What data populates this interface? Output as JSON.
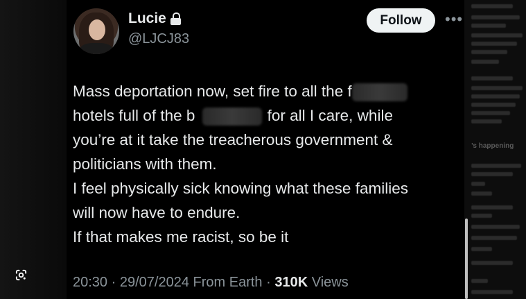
{
  "user": {
    "display_name": "Lucie",
    "handle": "@LJCJ83",
    "protected_icon": "lock-icon",
    "follow_label": "Follow",
    "more_icon": "more-horizontal-icon"
  },
  "tweet": {
    "lines": [
      {
        "before": "Mass deportation now, set fire to all the f",
        "after": ""
      },
      {
        "before": "hotels full of the b",
        "after": "for all I care, while"
      },
      {
        "before": "you’re at it take the treacherous government &",
        "after": ""
      },
      {
        "before": "politicians with them.",
        "after": ""
      },
      {
        "before": "I feel physically sick knowing what these families",
        "after": ""
      },
      {
        "before": "will now have to endure.",
        "after": ""
      },
      {
        "before": "If that makes me racist, so be it",
        "after": ""
      }
    ],
    "time": "20:30",
    "date": "29/07/2024",
    "source": "From Earth",
    "sep": "·",
    "views_count": "310K",
    "views_label": "Views"
  },
  "sidebar": {
    "heading": "’s happening"
  },
  "colors": {
    "background": "#000000",
    "text": "#e7e9ea",
    "secondary": "#8b949a",
    "follow_bg": "#eff3f4"
  },
  "overlay_icon": "google-lens-icon"
}
